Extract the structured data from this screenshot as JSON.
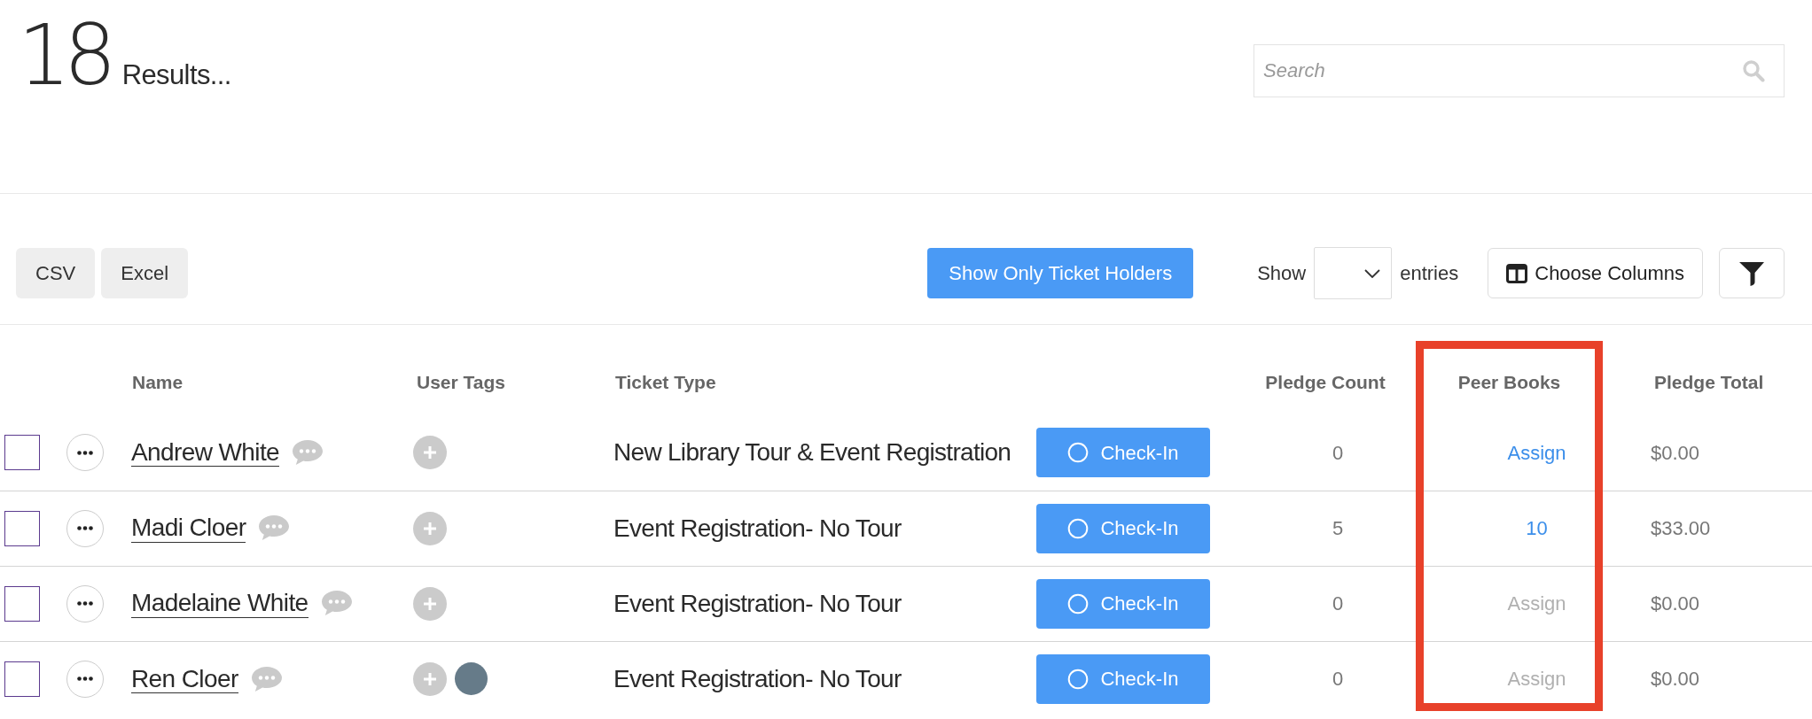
{
  "results": {
    "count": "18",
    "label": "Results..."
  },
  "search": {
    "placeholder": "Search"
  },
  "toolbar": {
    "exports": [
      {
        "label": "CSV"
      },
      {
        "label": "Excel"
      }
    ],
    "ticket_holders_button": {
      "label": "Show Only Ticket Holders"
    },
    "page_length": {
      "before": "Show",
      "after": "entries"
    },
    "choose_columns": {
      "label": "Choose Columns"
    }
  },
  "table": {
    "columns": [
      {
        "label": "Name",
        "highlighted": false
      },
      {
        "label": "User Tags",
        "highlighted": false
      },
      {
        "label": "Ticket Type",
        "highlighted": false
      },
      {
        "label": "Pledge Count",
        "highlighted": false
      },
      {
        "label": "Peer Books",
        "highlighted": true
      },
      {
        "label": "Pledge Total",
        "highlighted": false
      }
    ],
    "rows": [
      {
        "checked": false,
        "name": "Andrew White",
        "ticket_type": "New Library Tour & Event Registration",
        "check_in": {
          "label": "Check-In",
          "checked_in": false
        },
        "pledge_count": "0",
        "peer_books": {
          "text": "Assign",
          "disabled": false
        },
        "pledge_total": "$0.00"
      },
      {
        "checked": false,
        "name": "Madi Cloer",
        "ticket_type": "Event Registration- No Tour",
        "check_in": {
          "label": "Check-In",
          "checked_in": false
        },
        "pledge_count": "5",
        "peer_books": {
          "text": "10",
          "disabled": false
        },
        "pledge_total": "$33.00"
      },
      {
        "checked": false,
        "name": "Madelaine White",
        "ticket_type": "Event Registration- No Tour",
        "check_in": {
          "label": "Check-In",
          "checked_in": false
        },
        "pledge_count": "0",
        "peer_books": {
          "text": "Assign",
          "disabled": true
        },
        "pledge_total": "$0.00"
      },
      {
        "checked": false,
        "name": "Ren Cloer",
        "tags": [
          {
            "color": "#667b89"
          }
        ],
        "ticket_type": "Event Registration- No Tour",
        "check_in": {
          "label": "Check-In",
          "checked_in": false
        },
        "pledge_count": "0",
        "peer_books": {
          "text": "Assign",
          "disabled": true
        },
        "pledge_total": "$0.00"
      }
    ]
  }
}
